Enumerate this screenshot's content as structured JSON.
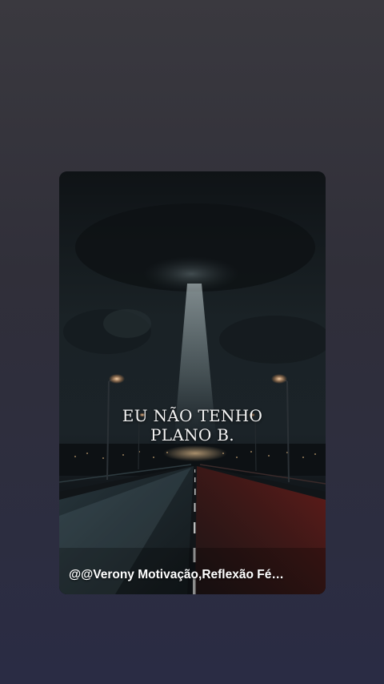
{
  "post": {
    "quote_line1": "EU NÃO TENHO",
    "quote_line2": "PLANO B.",
    "caption": "@@Verony Motivação,Reflexão Fé…"
  },
  "colors": {
    "background_top": "#3a393f",
    "background_bottom": "#2a2c44",
    "road_light_left": "#5f7c86",
    "road_light_right": "#c0241b",
    "sky": "#141a1f"
  }
}
